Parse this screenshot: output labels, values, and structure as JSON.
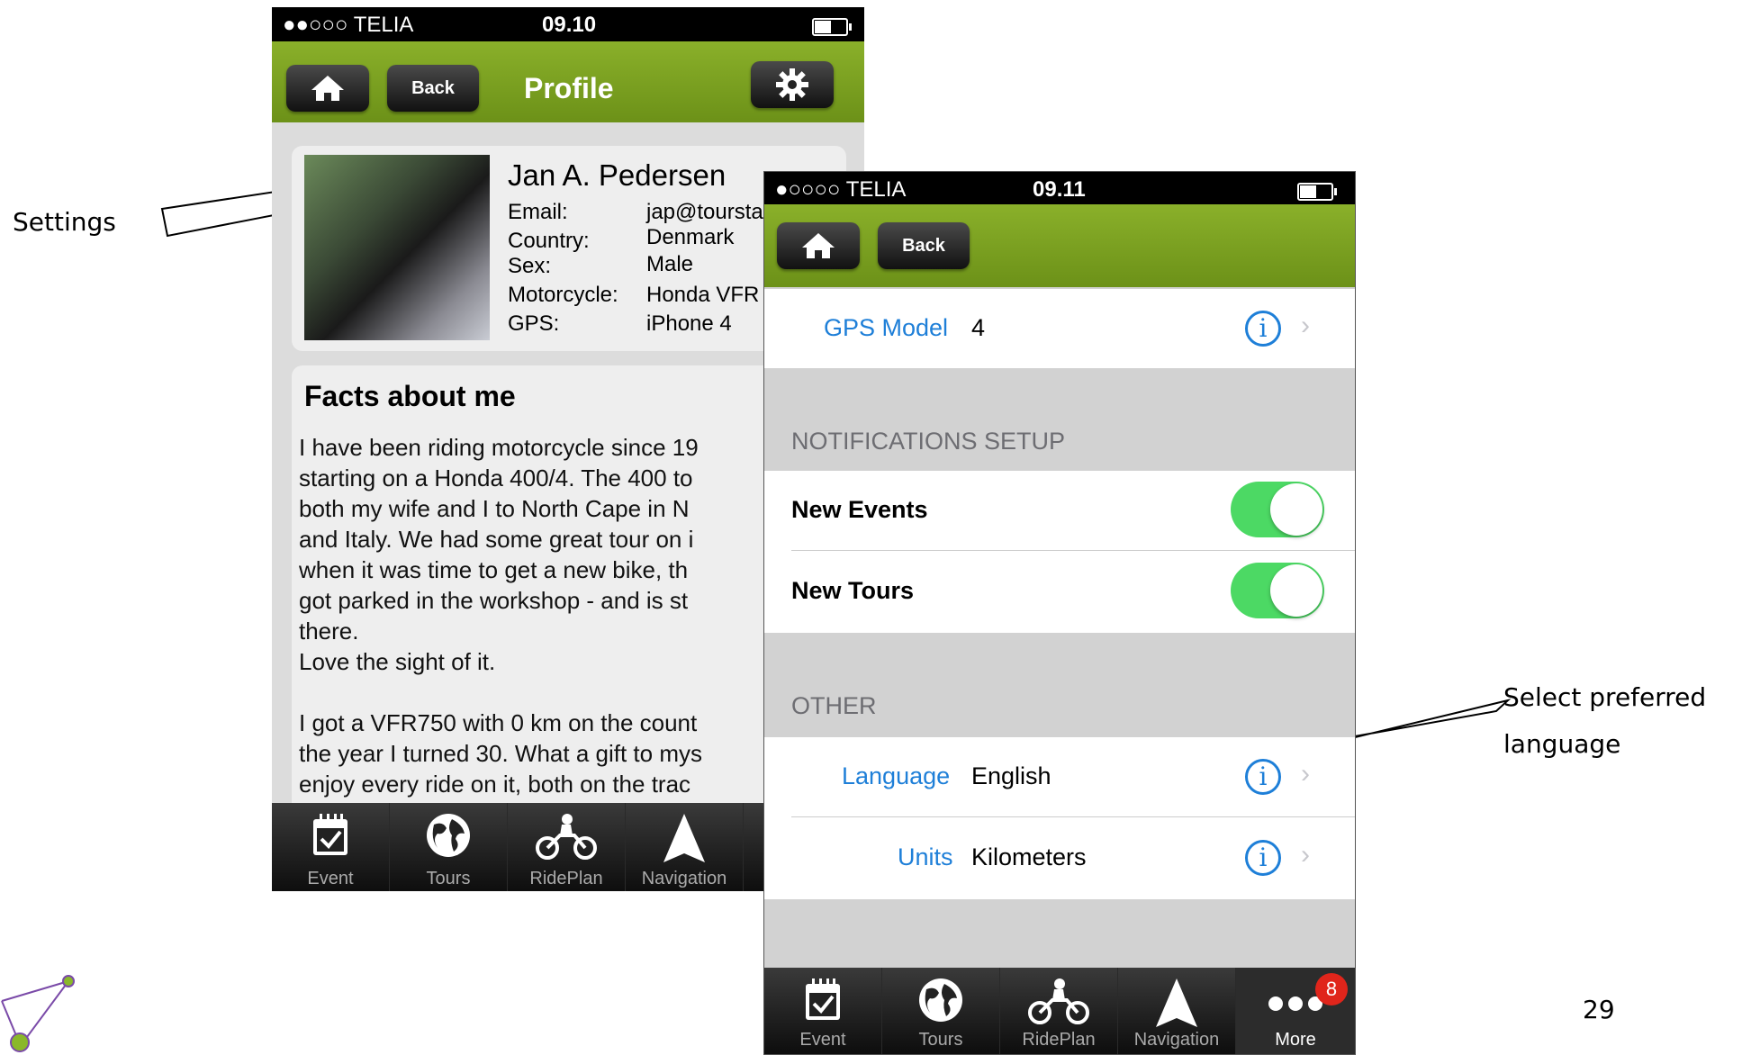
{
  "callouts": {
    "settings": "Settings",
    "language_line1": "Select preferred",
    "language_line2": "language"
  },
  "page_number": "29",
  "profile_screen": {
    "status": {
      "signal": "●●○○○ TELIA",
      "time": "09.10"
    },
    "nav": {
      "back_label": "Back",
      "title": "Profile"
    },
    "profile": {
      "name": "Jan A. Pedersen",
      "fields": [
        {
          "label": "Email:",
          "value": "jap@toursta"
        },
        {
          "label": "Country:",
          "value": "Denmark"
        },
        {
          "label": "Sex:",
          "value": "Male"
        },
        {
          "label": "Motorcycle:",
          "value": "Honda VFR"
        },
        {
          "label": "GPS:",
          "value": "iPhone 4"
        }
      ]
    },
    "facts": {
      "title": "Facts about me",
      "lines": [
        "I have been riding motorcycle since 19",
        "starting on a Honda 400/4. The 400 to",
        "both my wife and I to North Cape in N",
        "and Italy. We had some great tour on i",
        "when it was time to get a new bike, th",
        "got parked in the workshop - and is st",
        "there.",
        "Love the sight of it.",
        "",
        "I got a VFR750 with 0 km on the count",
        "the year I turned 30. What a gift to mys",
        "enjoy every ride on it, both on the trac"
      ]
    },
    "tabs": [
      "Event",
      "Tours",
      "RidePlan",
      "Navigation"
    ]
  },
  "settings_screen": {
    "status": {
      "signal": "●○○○○ TELIA",
      "time": "09.11"
    },
    "nav": {
      "back_label": "Back"
    },
    "gps": {
      "label": "GPS Model",
      "value": "4"
    },
    "notifications": {
      "header": "NOTIFICATIONS SETUP",
      "items": [
        {
          "label": "New Events",
          "on": true
        },
        {
          "label": "New Tours",
          "on": true
        }
      ]
    },
    "other": {
      "header": "OTHER",
      "language": {
        "label": "Language",
        "value": "English"
      },
      "units": {
        "label": "Units",
        "value": "Kilometers"
      }
    },
    "tabs": [
      "Event",
      "Tours",
      "RidePlan",
      "Navigation",
      "More"
    ],
    "more_badge": "8"
  },
  "colors": {
    "accent_green": "#7ba322",
    "ios_blue": "#1e7fd8",
    "toggle_on": "#4cd964",
    "badge_red": "#e0251b"
  }
}
